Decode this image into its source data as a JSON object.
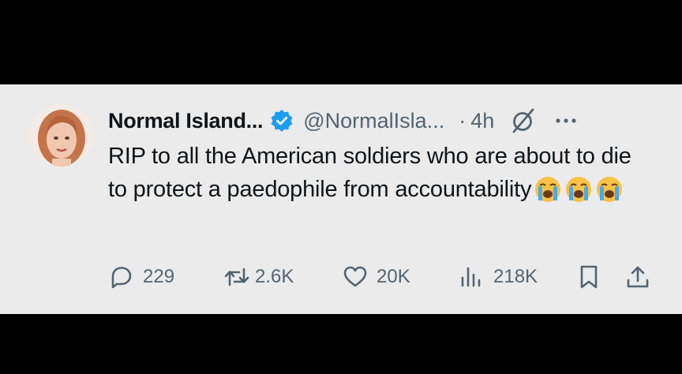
{
  "tweet": {
    "display_name": "Normal Island...",
    "handle": "@NormalIsla...",
    "dot": "·",
    "time": "4h",
    "text": "RIP to all the American soldiers who are about to die to protect a paedophile from accountability",
    "emojis": [
      "loudly-crying-face",
      "loudly-crying-face",
      "loudly-crying-face"
    ]
  },
  "actions": {
    "replies": "229",
    "reposts": "2.6K",
    "likes": "20K",
    "views": "218K"
  },
  "icons": {
    "verified": "verified-badge-icon",
    "grok": "grok-icon",
    "more": "more-icon",
    "reply": "reply-icon",
    "repost": "repost-icon",
    "like": "like-icon",
    "views": "views-icon",
    "bookmark": "bookmark-icon",
    "share": "share-icon"
  },
  "colors": {
    "card_background": "#ebebeb",
    "text": "#0f1419",
    "secondary": "#536471",
    "verified": "#1d9bf0",
    "letterbox": "#000000"
  }
}
